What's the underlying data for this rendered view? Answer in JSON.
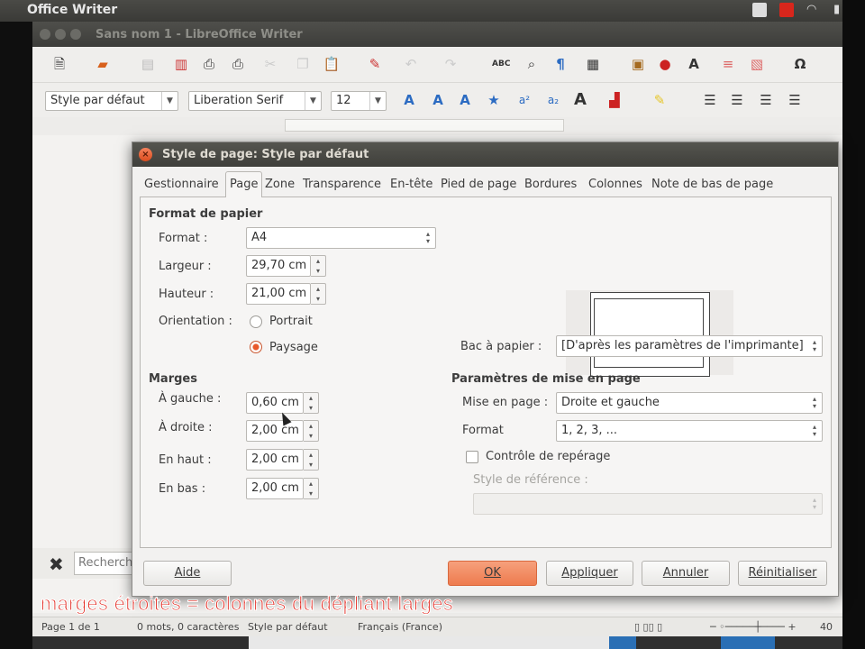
{
  "topbar": {
    "app_name": "Office Writer"
  },
  "writer": {
    "window_title": "Sans nom 1 - LibreOffice Writer",
    "style_combo": "Style par défaut",
    "font_combo": "Liberation Serif",
    "size_combo": "12",
    "find_placeholder": "Recherch"
  },
  "statusbar": {
    "page": "Page 1 de 1",
    "words": "0 mots, 0 caractères",
    "style": "Style par défaut",
    "language": "Français (France)",
    "zoom": "40"
  },
  "dialog": {
    "title": "Style de page: Style par défaut",
    "tabs": [
      "Gestionnaire",
      "Page",
      "Zone",
      "Transparence",
      "En-tête",
      "Pied de page",
      "Bordures",
      "Colonnes",
      "Note de bas de page"
    ],
    "active_tab": "Page",
    "paper": {
      "section": "Format de papier",
      "format_label": "Format :",
      "format_value": "A4",
      "width_label": "Largeur :",
      "width_value": "29,70 cm",
      "height_label": "Hauteur :",
      "height_value": "21,00 cm",
      "orientation_label": "Orientation :",
      "portrait": "Portrait",
      "landscape": "Paysage",
      "tray_label": "Bac à papier :",
      "tray_value": "[D'après les paramètres de l'imprimante]"
    },
    "margins": {
      "section": "Marges",
      "left_label": "À gauche :",
      "left_value": "0,60 cm",
      "right_label": "À droite :",
      "right_value": "2,00 cm",
      "top_label": "En haut :",
      "top_value": "2,00 cm",
      "bottom_label": "En bas :",
      "bottom_value": "2,00 cm"
    },
    "layout": {
      "section": "Paramètres de mise en page",
      "layout_label": "Mise en page :",
      "layout_value": "Droite et gauche",
      "format_label": "Format",
      "format_value": "1, 2, 3, ...",
      "register_label": "Contrôle de repérage",
      "ref_style_label": "Style de référence :"
    },
    "buttons": {
      "help": "Aide",
      "ok": "OK",
      "apply": "Appliquer",
      "cancel": "Annuler",
      "reset": "Réinitialiser"
    }
  },
  "caption": "marges étroites = colonnes du dépliant larges",
  "colors": {
    "accent": "#ee7b4e",
    "caption": "#e2231a"
  }
}
